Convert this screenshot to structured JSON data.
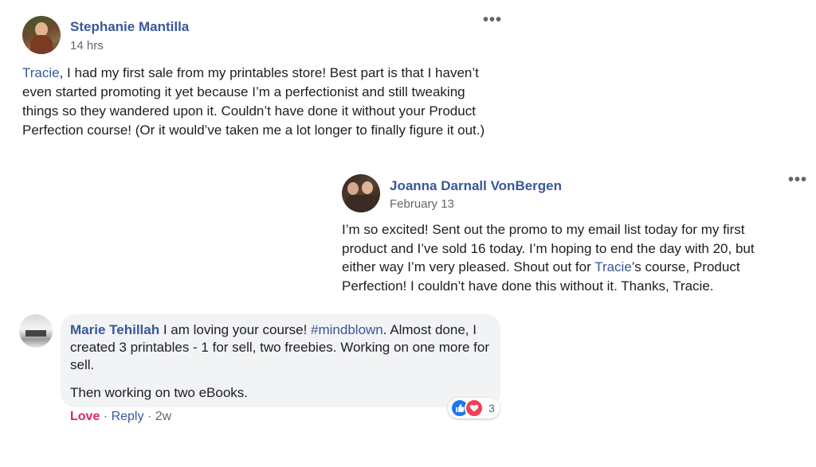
{
  "post1": {
    "author": "Stephanie Mantilla",
    "time": "14 hrs",
    "mention": "Tracie",
    "text_after_mention": ", I had my first sale from my printables store! Best part is that I haven’t even started promoting it yet because I’m a perfectionist and still tweaking things so they wandered upon it. Couldn’t have done it without your Product Perfection course! (Or it would’ve taken me a lot longer to finally figure it out.)",
    "options_label": "•••",
    "avatar_icon": "profile-photo-icon"
  },
  "post2": {
    "author": "Joanna Darnall VonBergen",
    "time": "February 13",
    "text_before_mention": "I’m so excited! Sent out the promo to my email list today for my first product and I’ve sold 16 today. I’m hoping to end the day with 20, but either way I’m very pleased. Shout out for ",
    "mention": "Tracie",
    "text_after_mention": "’s course, Product Perfection! I couldn’t have done this without it. Thanks, Tracie.",
    "options_label": "•••",
    "avatar_icon": "profile-photo-icon"
  },
  "comment": {
    "author": "Marie Tehillah",
    "text_part1": " I am loving your course! ",
    "hashtag": "#mindblown",
    "text_part2": ". Almost done, I created 3 printables - 1 for sell, two freebies. Working on one more for sell.",
    "paragraph2": "Then working on two eBooks.",
    "love_label": "Love",
    "separator": "·",
    "reply_label": "Reply",
    "time": "2w",
    "reaction_count": "3",
    "reaction_icons": [
      "like-icon",
      "love-icon"
    ],
    "avatar_icon": "profile-photo-icon"
  },
  "colors": {
    "link": "#385898",
    "love": "#e0245e",
    "bubble": "#f2f3f5",
    "like": "#1877f2",
    "meta": "#606770"
  }
}
